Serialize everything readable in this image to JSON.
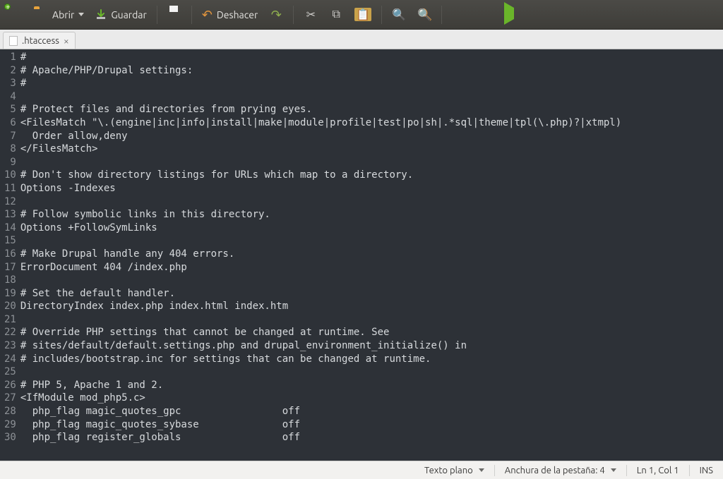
{
  "toolbar": {
    "open_label": "Abrir",
    "save_label": "Guardar",
    "undo_label": "Deshacer"
  },
  "tab": {
    "filename": ".htaccess"
  },
  "statusbar": {
    "language": "Texto plano",
    "tabwidth_label": "Anchura de la pestaña: 4",
    "cursor": "Ln 1, Col 1",
    "insert_mode": "INS"
  },
  "editor": {
    "first_line_no": 1,
    "lines": [
      "#",
      "# Apache/PHP/Drupal settings:",
      "#",
      "",
      "# Protect files and directories from prying eyes.",
      "<FilesMatch \"\\.(engine|inc|info|install|make|module|profile|test|po|sh|.*sql|theme|tpl(\\.php)?|xtmpl)",
      "  Order allow,deny",
      "</FilesMatch>",
      "",
      "# Don't show directory listings for URLs which map to a directory.",
      "Options -Indexes",
      "",
      "# Follow symbolic links in this directory.",
      "Options +FollowSymLinks",
      "",
      "# Make Drupal handle any 404 errors.",
      "ErrorDocument 404 /index.php",
      "",
      "# Set the default handler.",
      "DirectoryIndex index.php index.html index.htm",
      "",
      "# Override PHP settings that cannot be changed at runtime. See",
      "# sites/default/default.settings.php and drupal_environment_initialize() in",
      "# includes/bootstrap.inc for settings that can be changed at runtime.",
      "",
      "# PHP 5, Apache 1 and 2.",
      "<IfModule mod_php5.c>",
      "  php_flag magic_quotes_gpc                 off",
      "  php_flag magic_quotes_sybase              off",
      "  php_flag register_globals                 off"
    ]
  }
}
